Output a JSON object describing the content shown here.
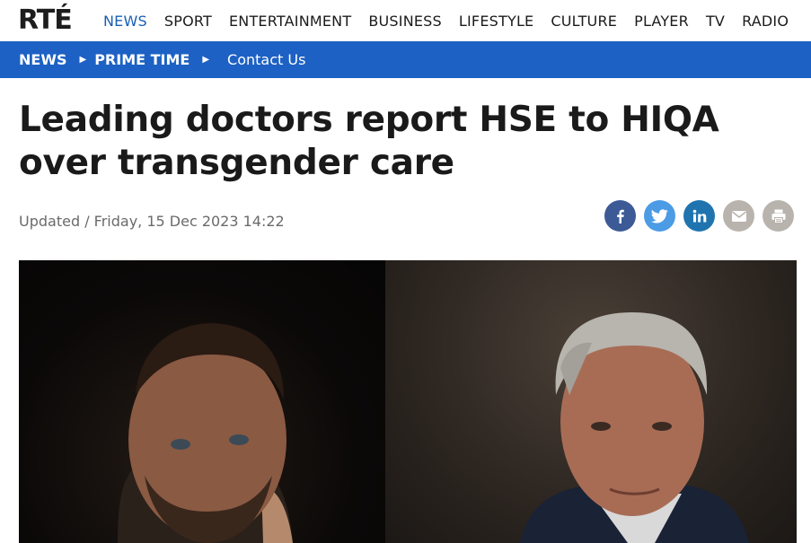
{
  "site": {
    "logo": "RTÉ",
    "nav": [
      "NEWS",
      "SPORT",
      "ENTERTAINMENT",
      "BUSINESS",
      "LIFESTYLE",
      "CULTURE",
      "PLAYER",
      "TV",
      "RADIO"
    ],
    "active_nav": "NEWS"
  },
  "breadcrumb": [
    "NEWS",
    "PRIME TIME",
    "Contact Us"
  ],
  "article": {
    "headline": "Leading doctors report HSE to HIQA over transgender care",
    "dateline": "Updated / Friday, 15 Dec 2023 14:22"
  },
  "share": [
    {
      "icon": "facebook-icon",
      "color": "#3b5a96"
    },
    {
      "icon": "twitter-icon",
      "color": "#4b9be5"
    },
    {
      "icon": "linkedin-icon",
      "color": "#1f74b0"
    },
    {
      "icon": "email-icon",
      "color": "#b9b3ad"
    },
    {
      "icon": "print-icon",
      "color": "#b9b3ad"
    }
  ],
  "hero": {
    "description": ""
  }
}
